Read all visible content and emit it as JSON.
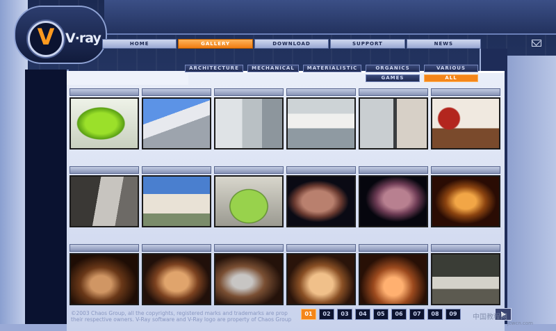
{
  "brand": {
    "logo_text": "V·ray",
    "logo_glyph": "V"
  },
  "nav": {
    "items": [
      {
        "label": "HOME"
      },
      {
        "label": "GALLERY",
        "active": true
      },
      {
        "label": "DOWNLOAD"
      },
      {
        "label": "SUPPORT"
      },
      {
        "label": "NEWS"
      }
    ],
    "mail_icon": "mail-icon"
  },
  "categories": [
    {
      "label": "ARCHITECTURE"
    },
    {
      "label": "MECHANICAL"
    },
    {
      "label": "MATERIALISTIC"
    },
    {
      "label": "ORGANICS"
    },
    {
      "label": "VARIOUS"
    },
    {
      "label": "GAMES"
    },
    {
      "label": "ALL",
      "active": true
    }
  ],
  "gallery": {
    "thumbnails": [
      "green-device",
      "architecture-exterior",
      "kitchen-interior",
      "kitchen-interior-2",
      "bathroom",
      "living-room",
      "staircase",
      "modern-building",
      "green-beetle-car",
      "creature",
      "creature-2",
      "golden-creature",
      "glass-bowl",
      "glass-bowl-2",
      "glass-with-straw",
      "glass-tumbler",
      "glass-bottle",
      "lounge-room"
    ]
  },
  "footer": {
    "copyright_line1": "©2003 Chaos Group, all the copyrights, registered marks and trademarks are prop",
    "copyright_line2": "their respective owners. V-Ray software and V-Ray logo are property of Chaos Group"
  },
  "pager": {
    "pages": [
      "01",
      "02",
      "03",
      "04",
      "05",
      "06",
      "07",
      "08",
      "09"
    ],
    "active": "01",
    "next_icon": "play-icon"
  },
  "watermark": {
    "line1": "中国教程网",
    "line2": "jcwcn.com"
  }
}
